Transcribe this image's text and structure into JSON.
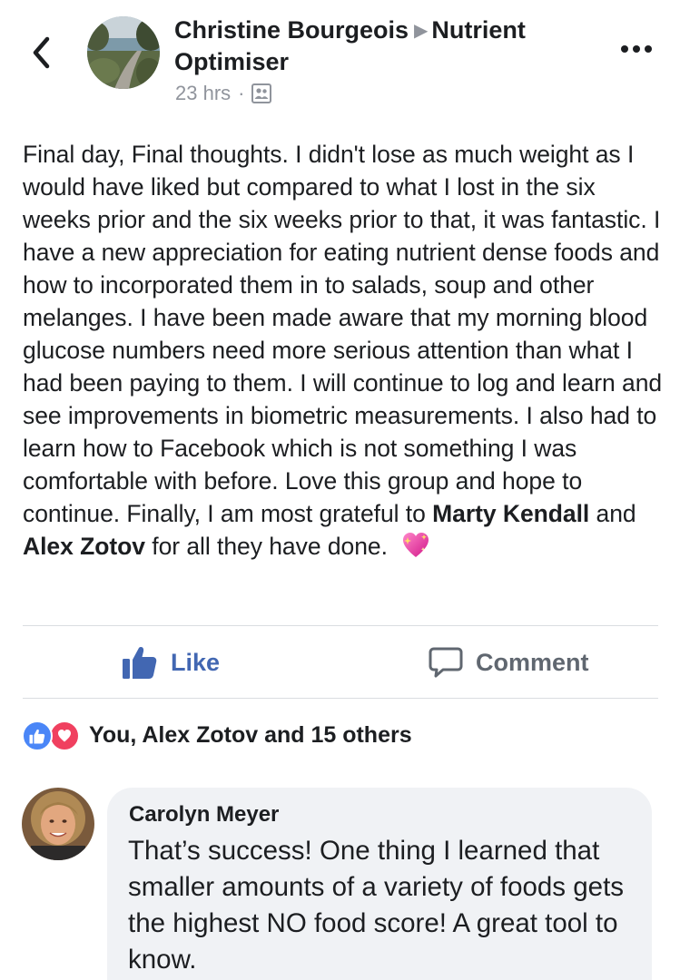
{
  "post": {
    "author": "Christine Bourgeois",
    "group": "Nutrient Optimiser",
    "time": "23 hrs",
    "separator": "·",
    "audience_icon": "group-audience-icon",
    "text_runs": [
      "Final day, Final thoughts.  I didn't lose as much weight as I would have liked but compared to what I lost in the six weeks prior and the six weeks prior to that, it was fantastic. I have a new appreciation for eating nutrient dense foods and how to incorporated them in to salads, soup and other melanges. I have been made aware that my morning blood glucose numbers need more serious attention than what I had been paying to them.  I will continue to log and learn and see improvements in biometric measurements.  I also had to learn how to Facebook which is not something I was comfortable with before.  Love this group and hope to continue. Finally, I am most grateful to ",
      "Marty Kendall",
      " and ",
      "Alex Zotov",
      " for all they have done."
    ],
    "emoji_icon": "sparkling-heart-icon"
  },
  "actions": {
    "like_label": "Like",
    "comment_label": "Comment"
  },
  "reactions": {
    "summary": "You, Alex Zotov and 15 others"
  },
  "comment": {
    "author": "Carolyn Meyer",
    "text": "That’s success! One thing I learned that smaller amounts of a variety of foods gets the highest NO food score! A great tool to know."
  },
  "colors": {
    "accent": "#4267b2",
    "muted": "#90949c",
    "like_reaction": "#4a86f7",
    "love_reaction": "#f0405f",
    "bubble": "#f0f2f5"
  }
}
